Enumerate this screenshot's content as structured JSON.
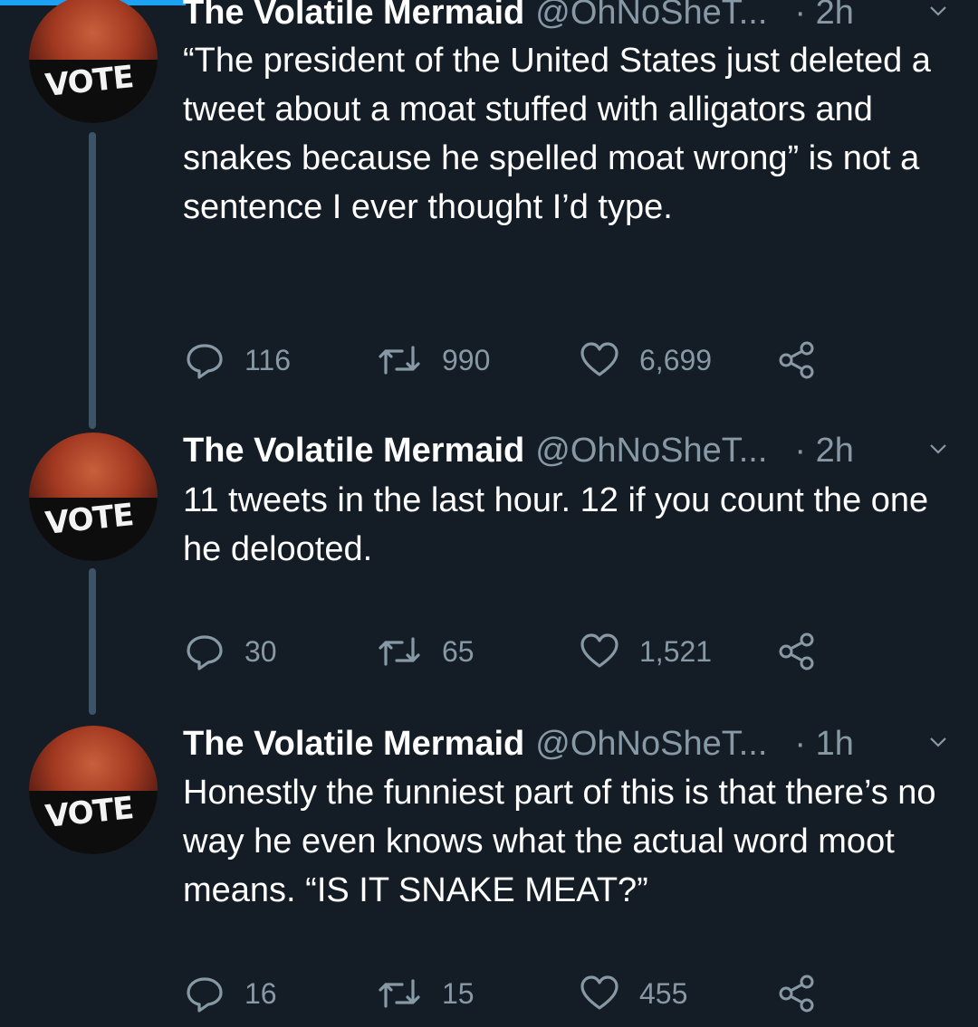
{
  "tweets": [
    {
      "name": "The Volatile Mermaid",
      "handle": "@OhNoSheT...",
      "time": "· 2h",
      "text": "“The president of the United States just deleted a tweet about a moat stuffed with alligators and snakes because he spelled moat wrong” is not a sentence I ever thought I’d type.",
      "replies": "116",
      "retweets": "990",
      "likes": "6,699",
      "avatar_text": "VOTE"
    },
    {
      "name": "The Volatile Mermaid",
      "handle": "@OhNoSheT...",
      "time": "· 2h",
      "text": "11 tweets in the last hour. 12 if you count the one he delooted.",
      "replies": "30",
      "retweets": "65",
      "likes": "1,521",
      "avatar_text": "VOTE"
    },
    {
      "name": "The Volatile Mermaid",
      "handle": "@OhNoSheT...",
      "time": "· 1h",
      "text": "Honestly the funniest part of this is that there’s no way he even knows what the actual word moot means. “IS IT SNAKE MEAT?”",
      "replies": "16",
      "retweets": "15",
      "likes": "455",
      "avatar_text": "VOTE"
    }
  ],
  "icons": {
    "reply": "reply-icon",
    "retweet": "retweet-icon",
    "like": "heart-icon",
    "share": "share-icon",
    "more": "chevron-down-icon"
  },
  "colors": {
    "background": "#141d26",
    "muted": "#8899a6",
    "thread_line": "#3d5466",
    "accent": "#1da1f2"
  }
}
